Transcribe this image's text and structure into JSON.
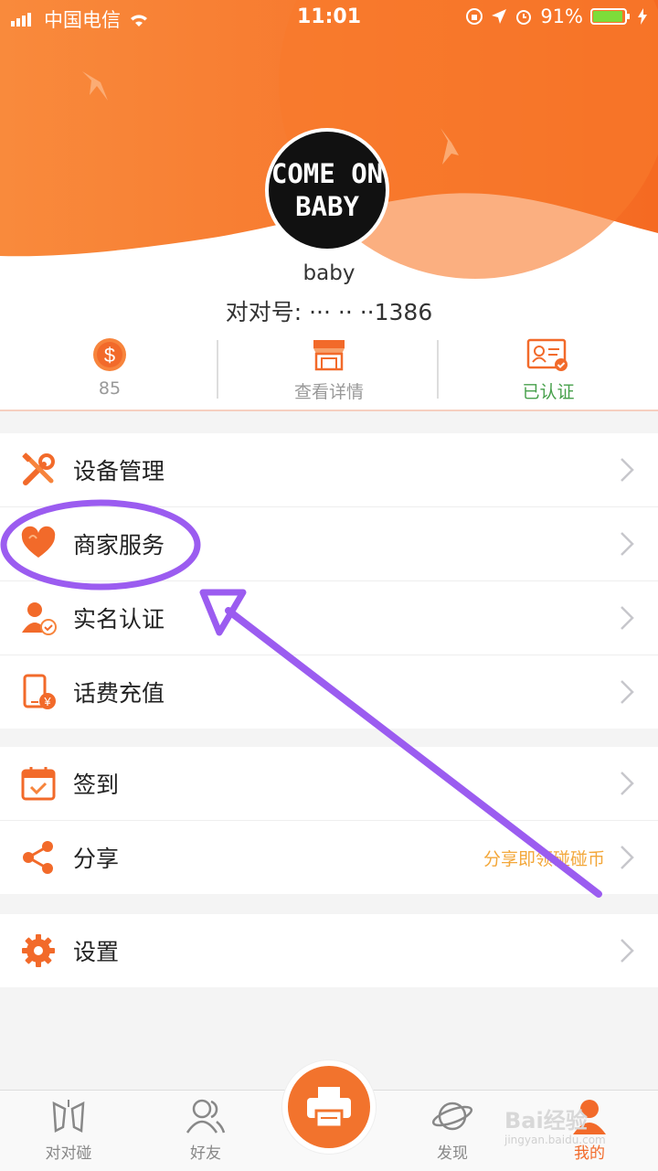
{
  "status_bar": {
    "carrier": "中国电信",
    "time": "11:01",
    "battery": "91%"
  },
  "profile": {
    "avatar_line1": "COME ON",
    "avatar_line2": "BABY",
    "username": "baby",
    "id_text": "对对号: ··· ·· ··1386"
  },
  "stats": [
    {
      "label": "85",
      "icon": "coin-icon"
    },
    {
      "label": "查看详情",
      "icon": "store-icon"
    },
    {
      "label": "已认证",
      "icon": "id-card-icon"
    }
  ],
  "menu_group1": [
    {
      "label": "设备管理",
      "icon": "tools-icon"
    },
    {
      "label": "商家服务",
      "icon": "heart-icon"
    },
    {
      "label": "实名认证",
      "icon": "user-verified-icon"
    },
    {
      "label": "话费充值",
      "icon": "phone-recharge-icon"
    }
  ],
  "menu_group2": [
    {
      "label": "签到",
      "icon": "calendar-check-icon"
    },
    {
      "label": "分享",
      "icon": "share-icon",
      "extra": "分享即领碰碰币"
    }
  ],
  "menu_group3": [
    {
      "label": "设置",
      "icon": "gear-icon"
    }
  ],
  "tabbar": [
    {
      "label": "对对碰",
      "icon": "bump-icon"
    },
    {
      "label": "好友",
      "icon": "friends-icon"
    },
    {
      "label": "打印",
      "icon": "printer-icon"
    },
    {
      "label": "发现",
      "icon": "planet-icon"
    },
    {
      "label": "我的",
      "icon": "me-icon",
      "active": true
    }
  ],
  "watermark": {
    "line1": "Bai经验",
    "line2": "jingyan.baidu.com"
  },
  "colors": {
    "accent": "#f26a2a",
    "annotation": "#9b5cf0",
    "verified": "#47a04b",
    "highlight_text": "#f3a73a"
  }
}
